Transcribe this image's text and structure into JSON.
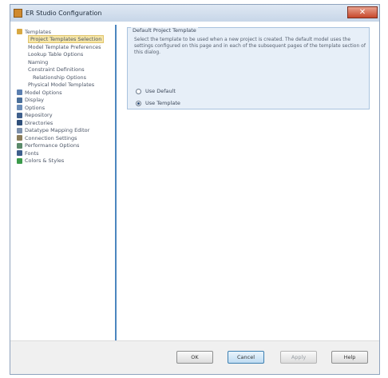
{
  "window": {
    "title": "ER Studio Configuration",
    "close_glyph": "✕"
  },
  "sidebar": {
    "items": [
      {
        "label": "Templates",
        "level": 0,
        "icon": "folder-icon",
        "color": "#d8a842"
      },
      {
        "label": "Project Templates Selection",
        "level": 1,
        "selected": true
      },
      {
        "label": "Model Template Preferences",
        "level": 1
      },
      {
        "label": "Lookup Table Options",
        "level": 1
      },
      {
        "label": "Naming",
        "level": 1
      },
      {
        "label": "Constraint Definitions",
        "level": 1
      },
      {
        "label": "Relationship Options",
        "level": 2
      },
      {
        "label": "Physical Model Templates",
        "level": 1
      },
      {
        "label": "Model Options",
        "level": 0,
        "icon": "model-icon",
        "color": "#5b7fb0"
      },
      {
        "label": "Display",
        "level": 0,
        "icon": "display-icon",
        "color": "#4a6f9a"
      },
      {
        "label": "Options",
        "level": 0,
        "icon": "options-icon",
        "color": "#6b8db8"
      },
      {
        "label": "Repository",
        "level": 0,
        "icon": "repository-icon",
        "color": "#3e5f8c"
      },
      {
        "label": "Directories",
        "level": 0,
        "icon": "directories-icon",
        "color": "#2f4f7a"
      },
      {
        "label": "Datatype Mapping Editor",
        "level": 0,
        "icon": "datatype-icon",
        "color": "#7c90ac"
      },
      {
        "label": "Connection Settings",
        "level": 0,
        "icon": "connection-icon",
        "color": "#8a7c5a"
      },
      {
        "label": "Performance Options",
        "level": 0,
        "icon": "performance-icon",
        "color": "#5a8a6a"
      },
      {
        "label": "Fonts",
        "level": 0,
        "icon": "fonts-icon",
        "color": "#3e5f8c"
      },
      {
        "label": "Colors & Styles",
        "level": 0,
        "icon": "colors-icon",
        "color": "#3a9a4a"
      }
    ]
  },
  "group": {
    "title": "Default Project Template",
    "description": "Select the template to be used when a new project is created. The default model uses the settings configured on this page and in each of the subsequent pages of the template section of this dialog.",
    "radios": [
      {
        "label": "Use Default",
        "checked": false
      },
      {
        "label": "Use Template",
        "checked": true
      }
    ]
  },
  "buttons": {
    "ok": "OK",
    "cancel": "Cancel",
    "apply": "Apply",
    "help": "Help"
  },
  "colors": {
    "accent": "#4c86bf",
    "selection": "#f6e6a8",
    "group_bg": "#e7eff8"
  }
}
